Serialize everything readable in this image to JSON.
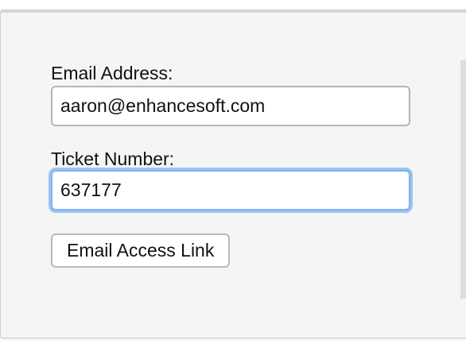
{
  "form": {
    "email_label": "Email Address:",
    "email_value": "aaron@enhancesoft.com",
    "ticket_label": "Ticket Number:",
    "ticket_value": "637177",
    "submit_label": "Email Access Link"
  },
  "colors": {
    "panel_background": "#f5f5f5",
    "focus_ring": "#9cc4f3",
    "input_border": "#b5b5b5"
  }
}
